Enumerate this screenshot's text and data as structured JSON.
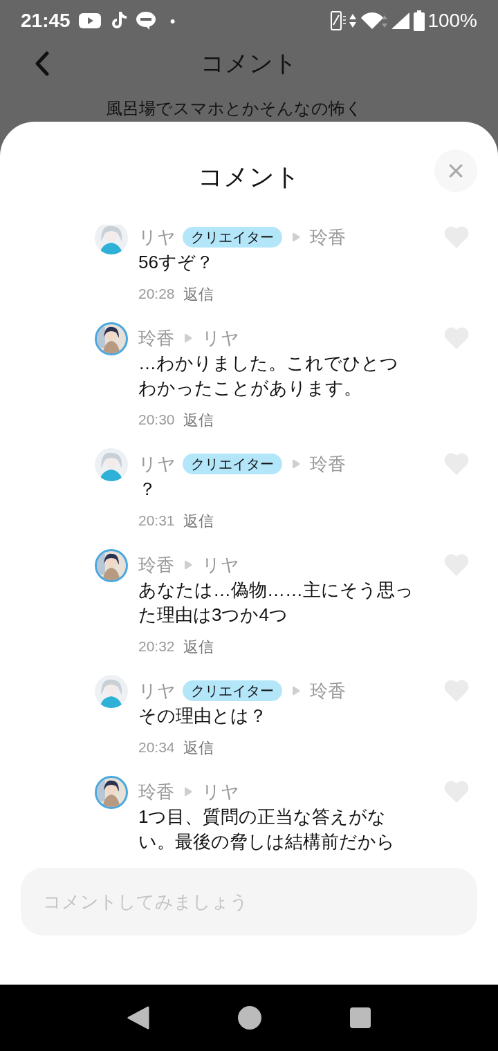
{
  "status_bar": {
    "time": "21:45",
    "notification_dot": "•",
    "battery": "100%"
  },
  "background_page": {
    "title": "コメント",
    "comment": {
      "text": "風呂場でスマホとかそんなの怖く"
    }
  },
  "sheet": {
    "title": "コメント",
    "close": "×",
    "comments": [
      {
        "author": "リヤ",
        "avatar_ring": false,
        "badge": "クリエイター",
        "reply_to": "玲香",
        "text": "56すぞ？",
        "time": "20:28",
        "reply": "返信",
        "liked": false
      },
      {
        "author": "玲香",
        "avatar_ring": true,
        "reply_to": "リヤ",
        "text": "…わかりました。これでひとつわかったことがあります。",
        "time": "20:30",
        "reply": "返信",
        "liked": false
      },
      {
        "author": "リヤ",
        "avatar_ring": false,
        "badge": "クリエイター",
        "reply_to": "玲香",
        "text": "？",
        "time": "20:31",
        "reply": "返信",
        "liked": false
      },
      {
        "author": "玲香",
        "avatar_ring": true,
        "reply_to": "リヤ",
        "text": "あなたは…偽物……主にそう思った理由は3つか4つ",
        "time": "20:32",
        "reply": "返信",
        "liked": false
      },
      {
        "author": "リヤ",
        "avatar_ring": false,
        "badge": "クリエイター",
        "reply_to": "玲香",
        "text": "その理由とは？",
        "time": "20:34",
        "reply": "返信",
        "liked": false
      },
      {
        "author": "玲香",
        "avatar_ring": true,
        "reply_to": "リヤ",
        "text": "1つ目、質問の正当な答えがない。最後の脅しは結構前だから",
        "liked": false
      }
    ],
    "input": {
      "placeholder": "コメントしてみましょう"
    }
  }
}
